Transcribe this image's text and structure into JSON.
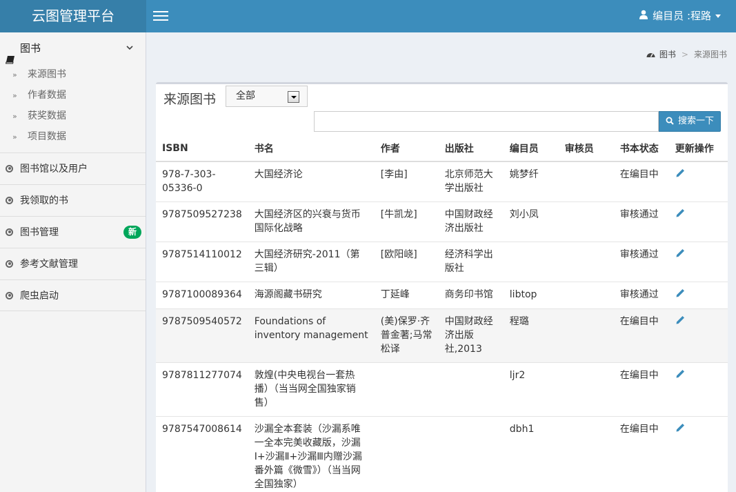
{
  "app": {
    "title": "云图管理平台"
  },
  "header": {
    "user_label": "编目员 :程路"
  },
  "sidebar": {
    "group": {
      "label": "图书",
      "items": [
        {
          "label": "来源图书"
        },
        {
          "label": "作者数据"
        },
        {
          "label": "获奖数据"
        },
        {
          "label": "项目数据"
        }
      ]
    },
    "items": [
      {
        "label": "图书馆以及用户"
      },
      {
        "label": "我领取的书"
      },
      {
        "label": "图书管理",
        "badge": "新"
      },
      {
        "label": "参考文献管理"
      },
      {
        "label": "爬虫启动"
      }
    ]
  },
  "breadcrumb": {
    "root": "图书",
    "current": "来源图书"
  },
  "main": {
    "title": "来源图书",
    "filter": {
      "selected": "全部"
    },
    "search": {
      "value": "",
      "button_label": "搜索一下"
    },
    "table": {
      "columns": [
        "ISBN",
        "书名",
        "作者",
        "出版社",
        "编目员",
        "审核员",
        "书本状态",
        "更新操作"
      ],
      "rows": [
        {
          "isbn": "978-7-303-05336-0",
          "name": "大国经济论",
          "author": "[李由]",
          "publisher": "北京师范大学出版社",
          "editor": "姚梦纤",
          "reviewer": "",
          "status": "在编目中"
        },
        {
          "isbn": "9787509527238",
          "name": "大国经济区的兴衰与货币国际化战略",
          "author": "[牛凯龙]",
          "publisher": "中国财政经济出版社",
          "editor": "刘小凤",
          "reviewer": "",
          "status": "审核通过"
        },
        {
          "isbn": "9787514110012",
          "name": "大国经济研究-2011（第三辑）",
          "author": "[欧阳峣]",
          "publisher": "经济科学出版社",
          "editor": "",
          "reviewer": "",
          "status": "审核通过"
        },
        {
          "isbn": "9787100089364",
          "name": "海源阁藏书研究",
          "author": "丁延峰",
          "publisher": "商务印书馆",
          "editor": "libtop",
          "reviewer": "",
          "status": "审核通过"
        },
        {
          "isbn": "9787509540572",
          "name": "Foundations of inventory management",
          "author": "(美)保罗·齐普金著;马常松译",
          "publisher": "中国财政经济出版社,2013",
          "editor": "程璐",
          "reviewer": "",
          "status": "在编目中"
        },
        {
          "isbn": "9787811277074",
          "name": "敦煌(中央电视台一套热播）（当当网全国独家销售）",
          "author": "",
          "publisher": "",
          "editor": "ljr2",
          "reviewer": "",
          "status": "在编目中"
        },
        {
          "isbn": "9787547008614",
          "name": "沙漏全本套装（沙漏系唯一全本完美收藏版，沙漏Ⅰ+沙漏Ⅱ+沙漏Ⅲ内赠沙漏番外篇《微雪》）（当当网全国独家）",
          "author": "",
          "publisher": "",
          "editor": "dbh1",
          "reviewer": "",
          "status": "在编目中"
        }
      ]
    }
  },
  "icons": {
    "edit": "pencil-icon",
    "accent": "#3c8dbc",
    "badge_color": "#00a65a"
  }
}
